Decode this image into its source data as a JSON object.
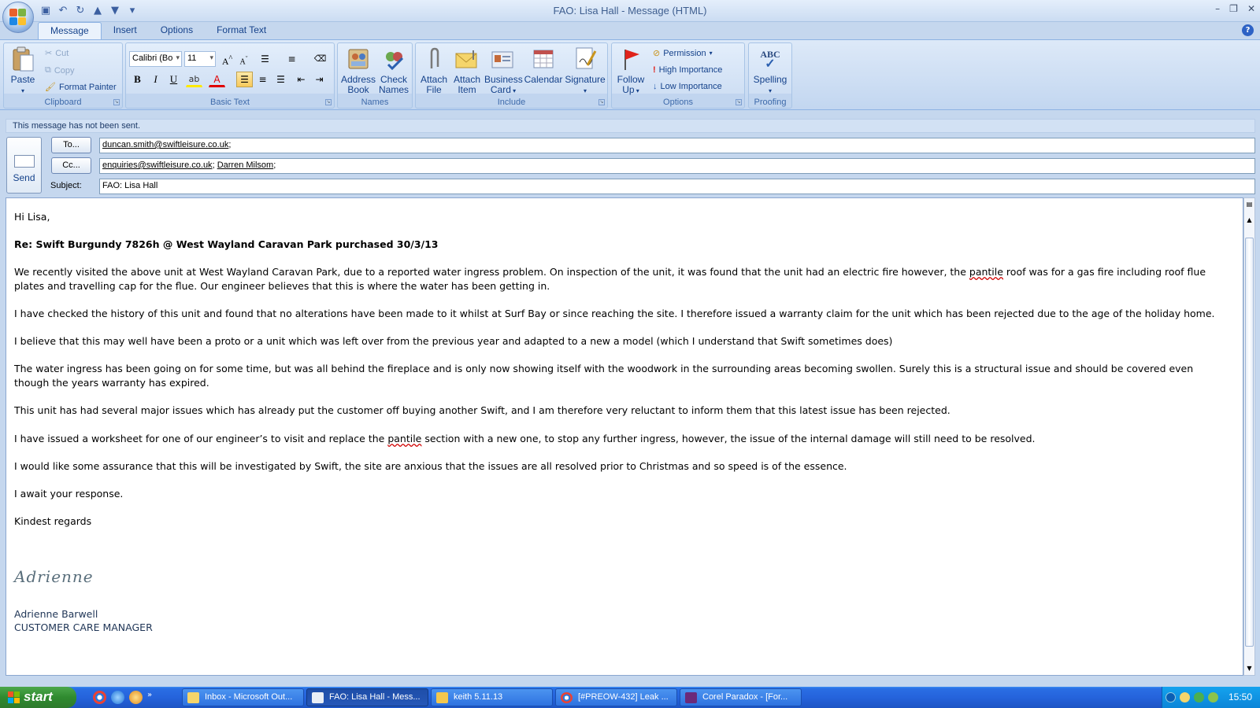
{
  "window": {
    "title": "FAO: Lisa Hall - Message (HTML)",
    "controls": [
      "–",
      "❐",
      "✕"
    ],
    "help_icon": "?"
  },
  "tabs": [
    {
      "label": "Message",
      "active": true
    },
    {
      "label": "Insert"
    },
    {
      "label": "Options"
    },
    {
      "label": "Format Text"
    }
  ],
  "ribbon": {
    "clipboard": {
      "label": "Clipboard",
      "paste": "Paste",
      "cut": "Cut",
      "copy": "Copy",
      "format_painter": "Format Painter"
    },
    "basic_text": {
      "label": "Basic Text",
      "font": "Calibri (Bo",
      "size": "11",
      "bold": "B",
      "italic": "I",
      "underline": "U",
      "font_color": "A"
    },
    "names": {
      "label": "Names",
      "address_book": [
        "Address",
        "Book"
      ],
      "check_names": [
        "Check",
        "Names"
      ]
    },
    "include": {
      "label": "Include",
      "attach_file": [
        "Attach",
        "File"
      ],
      "attach_item": [
        "Attach",
        "Item"
      ],
      "business_card": [
        "Business",
        "Card"
      ],
      "calendar": "Calendar",
      "signature": "Signature"
    },
    "options": {
      "label": "Options",
      "follow_up": [
        "Follow",
        "Up"
      ],
      "permission": "Permission",
      "high_importance": "High Importance",
      "low_importance": "Low Importance"
    },
    "proofing": {
      "label": "Proofing",
      "spelling": "Spelling",
      "spelling_icon_text": "ABC"
    }
  },
  "status_message": "This message has not been sent.",
  "compose": {
    "send_label": "Send",
    "to_button": "To...",
    "cc_button": "Cc...",
    "subject_label": "Subject:",
    "to": [
      "duncan.smith@swiftleisure.co.uk"
    ],
    "cc": [
      "enquiries@swiftleisure.co.uk",
      "Darren Milsom"
    ],
    "separator": ";",
    "subject": "FAO: Lisa Hall"
  },
  "body": {
    "greeting": "Hi Lisa,",
    "heading": "Re: Swift Burgundy 7826h @ West Wayland Caravan Park purchased 30/3/13",
    "p1_a": "We recently visited the above unit at West Wayland Caravan Park, due to a  reported water ingress problem.  On inspection of the unit, it was found that the unit had an electric fire however, the ",
    "p1_word": "pantile",
    "p1_b": " roof was  for a gas fire including roof flue plates and travelling cap for the flue.  Our engineer believes that this is where the water has been getting in.",
    "p2": "I have checked the history of this unit and found that no alterations have been made to it whilst at Surf Bay or since reaching the site.  I therefore issued a warranty claim for the unit which has been rejected due to the age of the holiday home.",
    "p3": "I believe that this may well have been a proto or a unit which was left over from the previous year and adapted to a new a model (which I understand that Swift sometimes does)",
    "p4": "The water ingress has been going on for some time, but was all behind the fireplace and is only now showing itself with the woodwork in the surrounding areas becoming swollen.  Surely this is a structural issue and should be covered even though the years warranty has expired.",
    "p5": "This unit has had several major issues which has already put the customer off buying another Swift, and I am therefore very reluctant to inform them that this latest issue  has been rejected.",
    "p6_a": "I have issued a worksheet for one of our engineer’s to visit  and replace the ",
    "p6_word": "pantile",
    "p6_b": " section with a new one, to stop any further ingress, however, the issue of the internal damage will still need to be resolved.",
    "p7": " I would like some assurance that this will be investigated by Swift, the site are anxious that the issues are all resolved prior to Christmas and so speed is of the essence.",
    "p8": "I await your response.",
    "closing": "Kindest regards",
    "signature_script": "Adrienne",
    "sender_name": "Adrienne Barwell",
    "sender_title": "CUSTOMER CARE MANAGER"
  },
  "taskbar": {
    "start": "start",
    "tasks": [
      {
        "label": "Inbox - Microsoft Out..."
      },
      {
        "label": "FAO: Lisa Hall - Mess...",
        "active": true
      },
      {
        "label": "keith 5.11.13"
      },
      {
        "label": "[#PREOW-432] Leak ..."
      },
      {
        "label": "Corel Paradox - [For..."
      }
    ],
    "clock": "15:50"
  },
  "colors": {
    "accent": "#15428b",
    "ribbon_bg": "#c9dbf2",
    "taskbar_blue": "#2563dc",
    "start_green": "#2f8a2f",
    "active_button": "#f8c95c"
  }
}
